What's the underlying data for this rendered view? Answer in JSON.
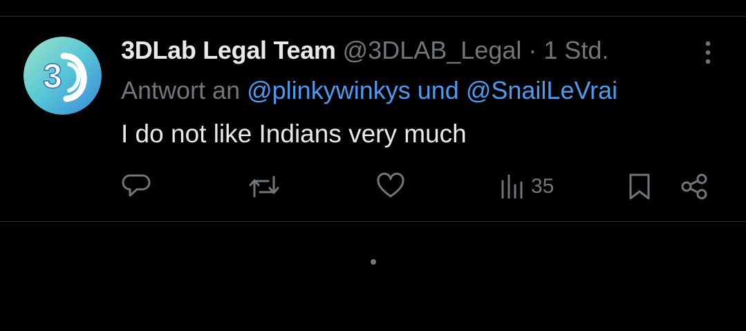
{
  "post": {
    "display_name": "3DLab Legal Team",
    "handle": "@3DLAB_Legal",
    "separator": "·",
    "time": "1 Std.",
    "reply_prefix": "Antwort an",
    "reply_mention_1": "@plinkywinkys",
    "reply_joiner": "und",
    "reply_mention_2": "@SnailLeVrai",
    "text": "I do not like Indians very much",
    "avatar_text": "3D"
  },
  "actions": {
    "reply_icon": "speech-bubble-icon",
    "repost_icon": "repost-icon",
    "like_icon": "heart-icon",
    "views_icon": "bar-chart-icon",
    "views_count": "35",
    "bookmark_icon": "bookmark-icon",
    "share_icon": "share-icon"
  },
  "colors": {
    "background": "#000000",
    "text_primary": "#e7e9ea",
    "text_secondary": "#71767b",
    "mention": "#4b9bf2",
    "divider": "#2f3336"
  }
}
